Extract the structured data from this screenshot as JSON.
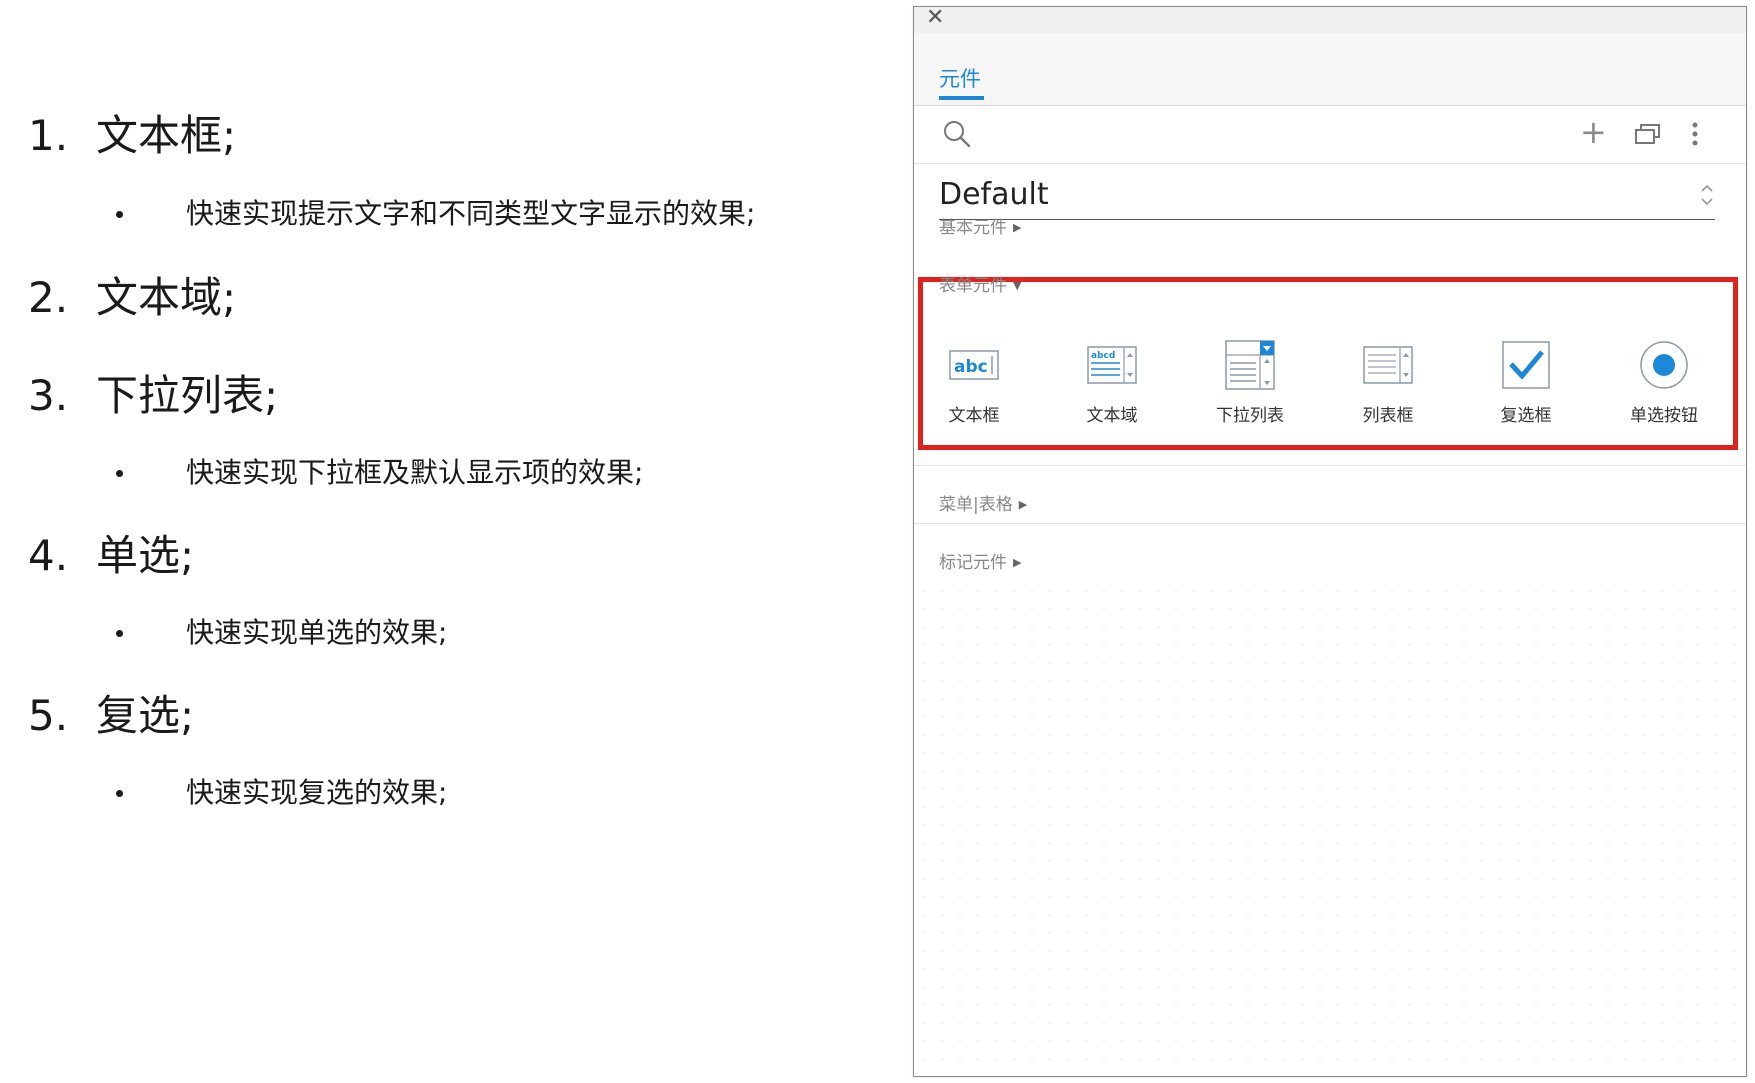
{
  "outline": {
    "items": [
      {
        "num": "1.",
        "title": "文本框;",
        "desc": "快速实现提示文字和不同类型文字显示的效果;"
      },
      {
        "num": "2.",
        "title": "文本域;",
        "desc": ""
      },
      {
        "num": "3.",
        "title": "下拉列表;",
        "desc": "快速实现下拉框及默认显示项的效果;"
      },
      {
        "num": "4.",
        "title": "单选;",
        "desc": "快速实现单选的效果;"
      },
      {
        "num": "5.",
        "title": "复选;",
        "desc": "快速实现复选的效果;"
      }
    ]
  },
  "panel": {
    "close_glyph": "✕",
    "tab_label": "元件",
    "add_glyph": "+",
    "library": "Default",
    "sections": {
      "basic": "基本元件",
      "form": "表单元件",
      "menu": "菜单|表格",
      "markup": "标记元件"
    },
    "arrows": {
      "collapsed": "▶",
      "expanded": "▼"
    },
    "widgets": [
      {
        "label": "文本框",
        "icon": "text-field-icon"
      },
      {
        "label": "文本域",
        "icon": "text-area-icon"
      },
      {
        "label": "下拉列表",
        "icon": "droplist-icon"
      },
      {
        "label": "列表框",
        "icon": "list-box-icon"
      },
      {
        "label": "复选框",
        "icon": "checkbox-icon"
      },
      {
        "label": "单选按钮",
        "icon": "radio-button-icon"
      }
    ],
    "icon_text": {
      "text_field": "abc",
      "text_area": "abcd"
    },
    "accent_color": "#1e88d8",
    "highlight_color": "#e0221d"
  }
}
